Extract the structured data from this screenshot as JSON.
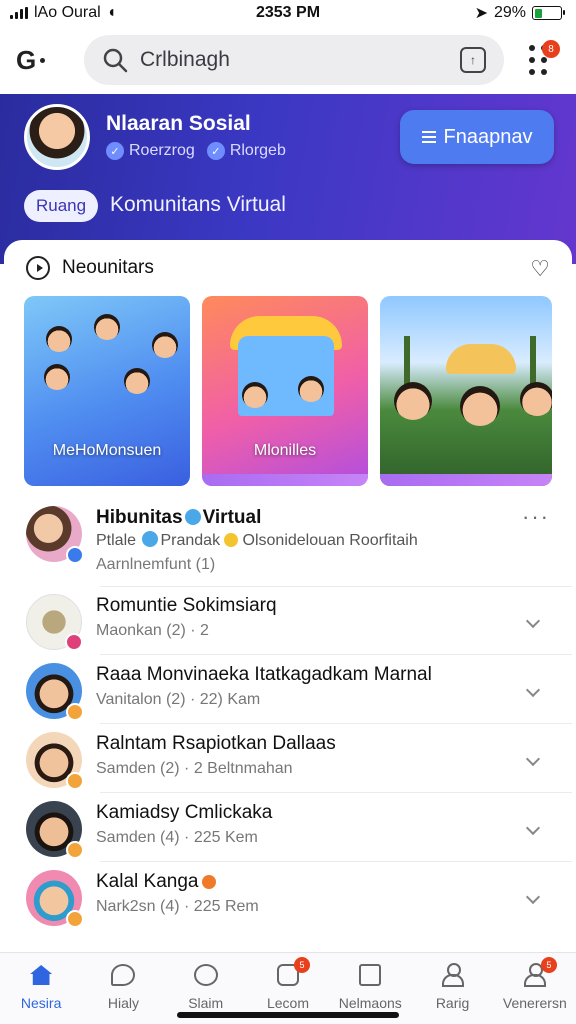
{
  "status_bar": {
    "carrier": "lAo Oural",
    "time": "2353 PM",
    "battery": "29%",
    "battery_level": 0.29,
    "icons": [
      "signal-icon",
      "wifi-icon",
      "location-icon",
      "battery-icon"
    ]
  },
  "top_bar": {
    "search_placeholder": "Crlbinagh",
    "menu_badge": "8",
    "icons": [
      "logo-icon",
      "search-icon",
      "share-icon",
      "menu-dots-icon"
    ]
  },
  "hero": {
    "name": "Nlaaran Sosial",
    "stat_1": "Roerzrog",
    "stat_2": "Rlorgeb",
    "action_label": "Fnaapnav",
    "chip_label": "Ruang",
    "subtitle": "Komunitans Virtual",
    "colors": {
      "gradient_start": "#2a2c9e",
      "gradient_end": "#6437cf",
      "button": "#4f7bf0"
    }
  },
  "section": {
    "title": "Neounitars",
    "icons": [
      "play-circle-icon",
      "heart-icon"
    ]
  },
  "media_cards": [
    {
      "label": "MeHoMonsuen"
    },
    {
      "label": "Mlonilles"
    },
    {
      "label": ""
    }
  ],
  "posts": [
    {
      "title": "Hibunitas",
      "title_suffix": "Virtual",
      "line_1_a": "Ptlale",
      "line_1_b": "Prandak",
      "line_1_c": "Olsonidelouan Roorfitaih",
      "meta": "Aarnlnemfunt (1)"
    },
    {
      "title": "Romuntie Sokimsiarq",
      "meta": "Maonkan (2) · 2"
    },
    {
      "title": "Raaa Monvinaeka Itatkagadkam Marnal",
      "meta": "Vanitalon (2) · 22) Kam"
    },
    {
      "title": "Ralntam Rsapiotkan Dallaas",
      "meta": "Samden (2) · 2 Beltnmahan"
    },
    {
      "title": "Kamiadsy Cmlickaka",
      "meta": "Samden (4) · 225 Kem"
    },
    {
      "title": "Kalal Kanga",
      "meta": "Nark2sn (4) · 225 Rem"
    }
  ],
  "bottom_nav": [
    {
      "label": "Nesira",
      "icon": "home-icon",
      "active": true
    },
    {
      "label": "Hialy",
      "icon": "chat-bubble-icon"
    },
    {
      "label": "Slaim",
      "icon": "group-icon"
    },
    {
      "label": "Lecom",
      "icon": "inbox-icon",
      "badge": "5"
    },
    {
      "label": "Nelmaons",
      "icon": "calendar-icon"
    },
    {
      "label": "Rarig",
      "icon": "person-icon"
    },
    {
      "label": "Venerersn",
      "icon": "profile-icon",
      "badge": "5"
    }
  ]
}
